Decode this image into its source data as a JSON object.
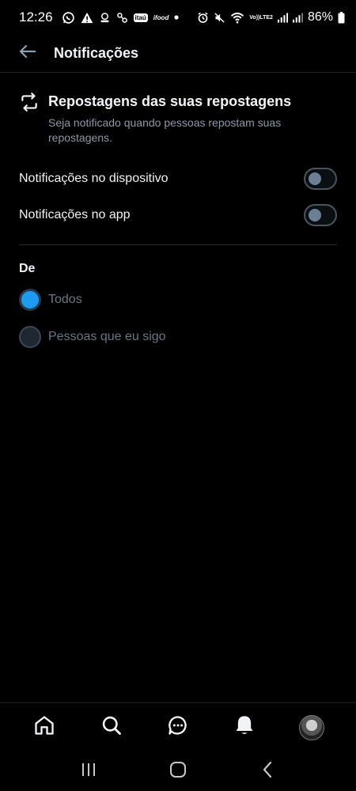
{
  "status_bar": {
    "time": "12:26",
    "battery": "86%",
    "left_icons": [
      "whatsapp-icon",
      "warning-icon",
      "ai-icon",
      "link-icon",
      "itau-icon",
      "ifood-icon",
      "dot-icon"
    ],
    "right_icons": [
      "alarm-icon",
      "mute-icon",
      "wifi-icon",
      "volte-icon",
      "signal-icon",
      "signal-icon",
      "battery-icon"
    ],
    "itau_label": "itaú",
    "ifood_label": "ifood",
    "volte_top": "Vo))",
    "volte_bottom": "LTE2"
  },
  "header": {
    "title": "Notificações",
    "back_icon": "arrow-left-icon"
  },
  "section": {
    "icon": "repost-icon",
    "title": "Repostagens das suas repostagens",
    "description": "Seja notificado quando pessoas repostam suas repostagens."
  },
  "toggles": [
    {
      "label": "Notificações no dispositivo",
      "on": false
    },
    {
      "label": "Notificações no app",
      "on": false
    }
  ],
  "from_group": {
    "label": "De",
    "options": [
      {
        "label": "Todos",
        "selected": true
      },
      {
        "label": "Pessoas que eu sigo",
        "selected": false
      }
    ]
  },
  "bottom_nav": {
    "items": [
      "home-icon",
      "search-icon",
      "messages-icon",
      "notifications-icon",
      "profile-avatar"
    ],
    "active": "notifications-icon"
  },
  "system_nav": [
    "recents-icon",
    "home-button-icon",
    "back-icon"
  ],
  "colors": {
    "background": "#000000",
    "accent": "#1d9bf0",
    "text_primary": "#f1f3f5",
    "text_secondary": "#8b98a5",
    "divider": "#24292e"
  }
}
